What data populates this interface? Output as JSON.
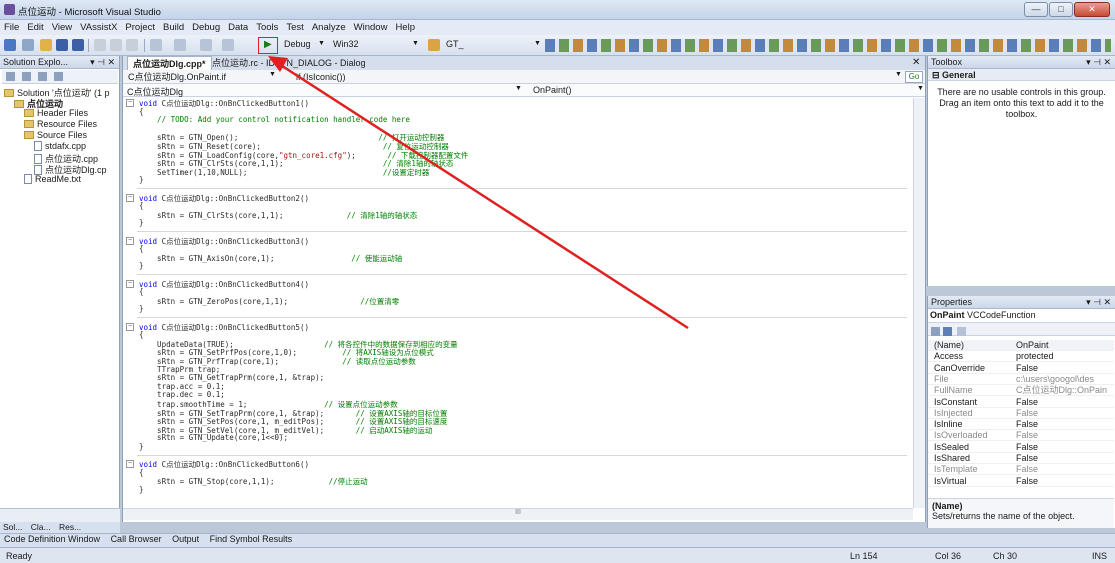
{
  "window": {
    "title": "点位运动 - Microsoft Visual Studio",
    "controls": [
      "—",
      "□",
      "✕"
    ]
  },
  "menu": [
    "File",
    "Edit",
    "View",
    "VAssistX",
    "Project",
    "Build",
    "Debug",
    "Data",
    "Tools",
    "Test",
    "Analyze",
    "Window",
    "Help"
  ],
  "toolbar": {
    "config": "Debug",
    "platform": "Win32",
    "find_value": "GT_",
    "start_glyph": "▶"
  },
  "solution_explorer": {
    "title": "Solution Explo...",
    "pin": "▾ ⊣ ✕",
    "tree": [
      {
        "label": "Solution '点位运动' (1 p",
        "indent": 0,
        "kind": "solution"
      },
      {
        "label": "点位运动",
        "indent": 1,
        "kind": "project"
      },
      {
        "label": "Header Files",
        "indent": 2,
        "kind": "folder"
      },
      {
        "label": "Resource Files",
        "indent": 2,
        "kind": "folder"
      },
      {
        "label": "Source Files",
        "indent": 2,
        "kind": "folder"
      },
      {
        "label": "stdafx.cpp",
        "indent": 3,
        "kind": "file"
      },
      {
        "label": "点位运动.cpp",
        "indent": 3,
        "kind": "file"
      },
      {
        "label": "点位运动Dlg.cp",
        "indent": 3,
        "kind": "file"
      },
      {
        "label": "ReadMe.txt",
        "indent": 2,
        "kind": "file"
      }
    ],
    "bottom_tabs": [
      "Sol...",
      "Cla...",
      "Res..."
    ]
  },
  "editor": {
    "tabs": [
      "点位运动Dlg.cpp*",
      "点位运动.rc - IDD_N_DIALOG - Dialog"
    ],
    "close": "✕",
    "nav_left": "C点位运动Dlg.OnPaint.if",
    "nav_right": "if (IsIconic())",
    "go_label": "Go",
    "scope_left": "C点位运动Dlg",
    "scope_right": "OnPaint()",
    "code": [
      {
        "t": "void C点位运动Dlg::OnBnClickedButton1()",
        "c": "sig"
      },
      {
        "t": "{",
        "c": ""
      },
      {
        "t": "    // TODO: Add your control notification handler code here",
        "c": "cm"
      },
      {
        "t": "",
        "c": ""
      },
      {
        "t": "    sRtn = GTN_Open();                               // 打开运动控制器",
        "c": "mix"
      },
      {
        "t": "    sRtn = GTN_Reset(core);                           // 复位运动控制器",
        "c": "mix"
      },
      {
        "t": "    sRtn = GTN_LoadConfig(core,\"gtn_core1.cfg\");       // 下载控制器配置文件",
        "c": "mix"
      },
      {
        "t": "    sRtn = GTN_ClrSts(core,1,1);                      // 清除1轴的轴状态",
        "c": "mix"
      },
      {
        "t": "    SetTimer(1,10,NULL);                              //设置定时器",
        "c": "mix"
      },
      {
        "t": "}",
        "c": ""
      },
      {
        "t": "",
        "c": "sep"
      },
      {
        "t": "void C点位运动Dlg::OnBnClickedButton2()",
        "c": "sig"
      },
      {
        "t": "{",
        "c": ""
      },
      {
        "t": "    sRtn = GTN_ClrSts(core,1,1);              // 清除1轴的轴状态",
        "c": "mix"
      },
      {
        "t": "}",
        "c": ""
      },
      {
        "t": "",
        "c": "sep"
      },
      {
        "t": "void C点位运动Dlg::OnBnClickedButton3()",
        "c": "sig"
      },
      {
        "t": "{",
        "c": ""
      },
      {
        "t": "    sRtn = GTN_AxisOn(core,1);                 // 使能运动轴",
        "c": "mix"
      },
      {
        "t": "}",
        "c": ""
      },
      {
        "t": "",
        "c": "sep"
      },
      {
        "t": "void C点位运动Dlg::OnBnClickedButton4()",
        "c": "sig"
      },
      {
        "t": "{",
        "c": ""
      },
      {
        "t": "    sRtn = GTN_ZeroPos(core,1,1);                //位置清零",
        "c": "mix"
      },
      {
        "t": "}",
        "c": ""
      },
      {
        "t": "",
        "c": "sep"
      },
      {
        "t": "void C点位运动Dlg::OnBnClickedButton5()",
        "c": "sig"
      },
      {
        "t": "{",
        "c": ""
      },
      {
        "t": "    UpdateData(TRUE);                    // 将各控件中的数据保存到相应的变量",
        "c": "mix"
      },
      {
        "t": "    sRtn = GTN_SetPrfPos(core,1,0);          // 将AXIS轴设为点位模式",
        "c": "mix"
      },
      {
        "t": "    sRtn = GTN_PrfTrap(core,1);              // 读取点位运动参数",
        "c": "mix"
      },
      {
        "t": "    TTrapPrm trap;",
        "c": ""
      },
      {
        "t": "    sRtn = GTN_GetTrapPrm(core,1, &trap);",
        "c": ""
      },
      {
        "t": "    trap.acc = 0.1;",
        "c": ""
      },
      {
        "t": "    trap.dec = 0.1;",
        "c": ""
      },
      {
        "t": "    trap.smoothTime = 1;                 // 设置点位运动参数",
        "c": "mix"
      },
      {
        "t": "    sRtn = GTN_SetTrapPrm(core,1, &trap);       // 设置AXIS轴的目标位置",
        "c": "mix"
      },
      {
        "t": "    sRtn = GTN_SetPos(core,1, m_editPos);       // 设置AXIS轴的目标速度",
        "c": "mix"
      },
      {
        "t": "    sRtn = GTN_SetVel(core,1, m_editVel);       // 启动AXIS轴的运动",
        "c": "mix"
      },
      {
        "t": "    sRtn = GTN_Update(core,1<<0);",
        "c": ""
      },
      {
        "t": "}",
        "c": ""
      },
      {
        "t": "",
        "c": "sep"
      },
      {
        "t": "void C点位运动Dlg::OnBnClickedButton6()",
        "c": "sig"
      },
      {
        "t": "{",
        "c": ""
      },
      {
        "t": "    sRtn = GTN_Stop(core,1,1);            //停止运动",
        "c": "mix"
      },
      {
        "t": "}",
        "c": ""
      }
    ],
    "hscroll_mark": "III"
  },
  "toolbox": {
    "title": "Toolbox",
    "pin": "▾ ⊣ ✕",
    "group": "General",
    "empty_message": "There are no usable controls in this group. Drag an item onto this text to add it to the toolbox."
  },
  "properties": {
    "title": "Properties",
    "pin": "▾ ⊣ ✕",
    "object": "OnPaint",
    "object_type": "VCCodeFunction",
    "rows": [
      {
        "name": "(Name)",
        "value": "OnPaint",
        "dim": false
      },
      {
        "name": "Access",
        "value": "protected",
        "dim": false
      },
      {
        "name": "CanOverride",
        "value": "False",
        "dim": false
      },
      {
        "name": "File",
        "value": "c:\\users\\googol\\des",
        "dim": true
      },
      {
        "name": "FullName",
        "value": "C点位运动Dlg::OnPain",
        "dim": true
      },
      {
        "name": "IsConstant",
        "value": "False",
        "dim": false
      },
      {
        "name": "IsInjected",
        "value": "False",
        "dim": true
      },
      {
        "name": "IsInline",
        "value": "False",
        "dim": false
      },
      {
        "name": "IsOverloaded",
        "value": "False",
        "dim": true
      },
      {
        "name": "IsSealed",
        "value": "False",
        "dim": false
      },
      {
        "name": "IsShared",
        "value": "False",
        "dim": false
      },
      {
        "name": "IsTemplate",
        "value": "False",
        "dim": true
      },
      {
        "name": "IsVirtual",
        "value": "False",
        "dim": false
      }
    ],
    "desc_title": "(Name)",
    "desc_text": "Sets/returns the name of the object."
  },
  "bottom_tabs": [
    "Code Definition Window",
    "Call Browser",
    "Output",
    "Find Symbol Results"
  ],
  "status": {
    "ready": "Ready",
    "line": "Ln 154",
    "col": "Col 36",
    "ch": "Ch 30",
    "ins": "INS"
  },
  "colors": {
    "annotation": "#e02020",
    "keyword": "#0000ff",
    "comment": "#008000"
  }
}
